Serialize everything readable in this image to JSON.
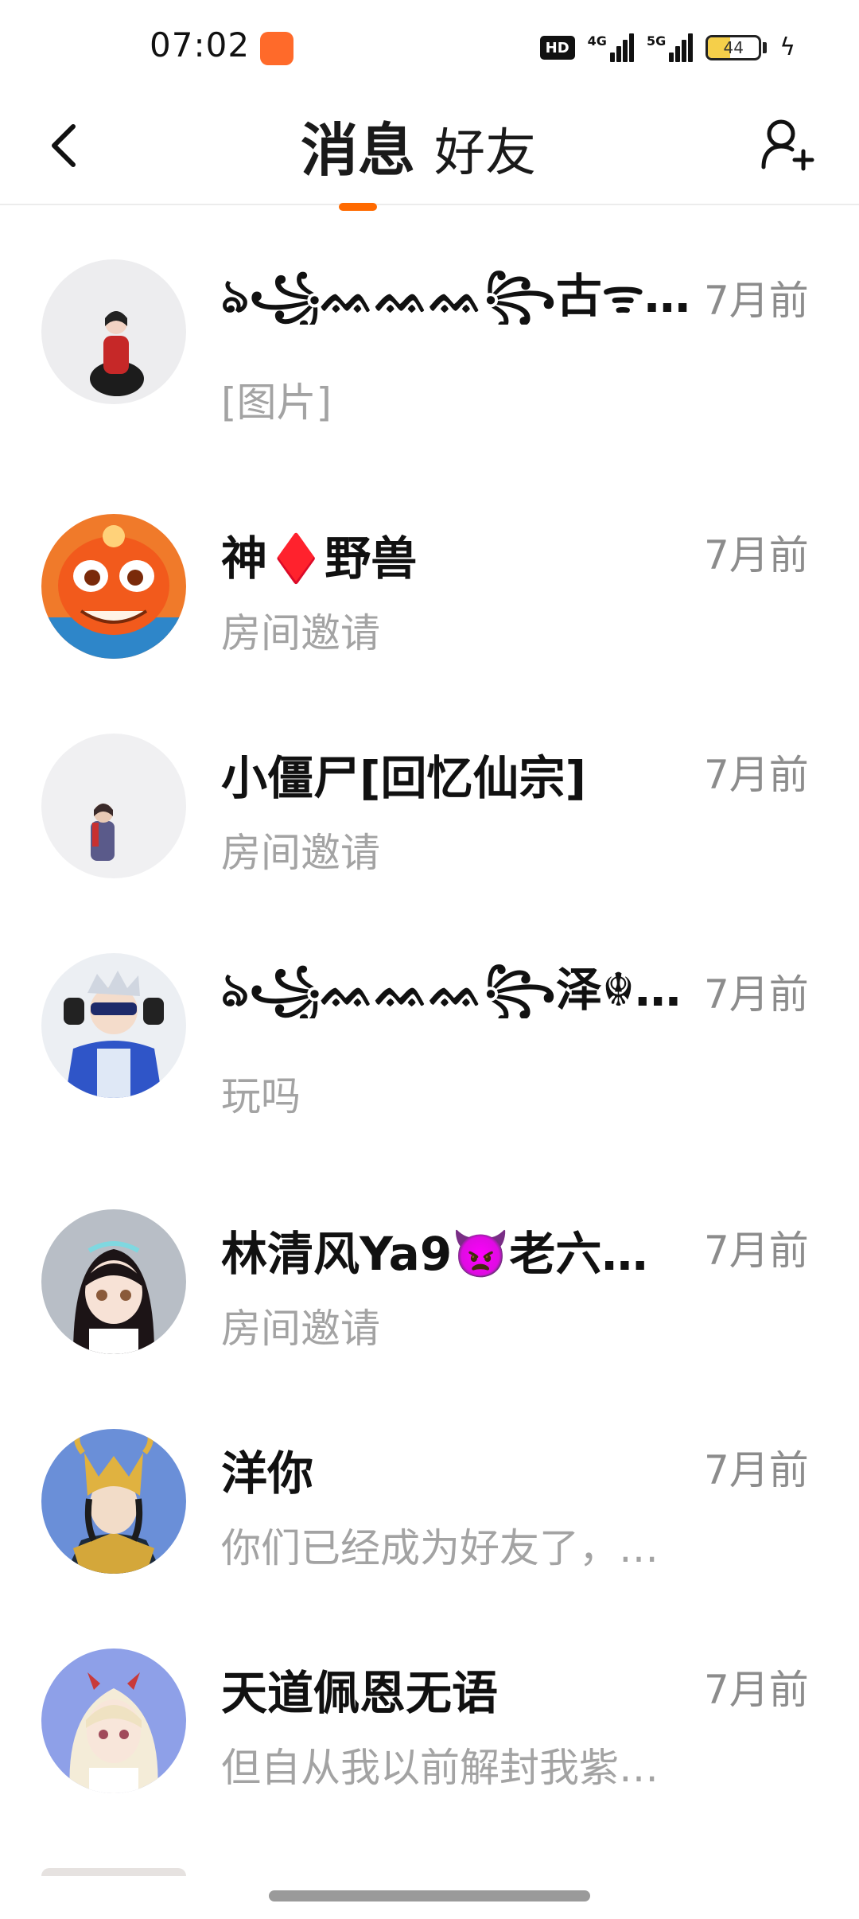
{
  "status_bar": {
    "time": "07:02",
    "hd_label": "HD",
    "network_1": "4G",
    "network_2": "5G",
    "battery_level": "44",
    "battery_fraction": 0.44
  },
  "header": {
    "tab_messages": "消息",
    "tab_friends": "好友",
    "active_tab": "消息"
  },
  "conversations": [
    {
      "name": "ঌ꧁ᨐᨐᨐ꧂古ᯤ兹꧁ᨐᨐᨐ꧂…",
      "time": "7月前",
      "preview": "[图片]"
    },
    {
      "name": "神♦️野兽",
      "time": "7月前",
      "preview": "房间邀请"
    },
    {
      "name": "小僵尸[回忆仙宗]",
      "time": "7月前",
      "preview": "房间邀请"
    },
    {
      "name": "ঌ꧁ᨐᨐᨐ꧂泽☬川꧁ᨐᨐᨐ꧂…",
      "time": "7月前",
      "preview": "玩吗"
    },
    {
      "name": "林清风Ya9👿老六…",
      "time": "7月前",
      "preview": "房间邀请"
    },
    {
      "name": "洋你",
      "time": "7月前",
      "preview": "你们已经成为好友了，…"
    },
    {
      "name": "天道佩恩无语",
      "time": "7月前",
      "preview": "但自从我以前解封我紫…"
    }
  ]
}
